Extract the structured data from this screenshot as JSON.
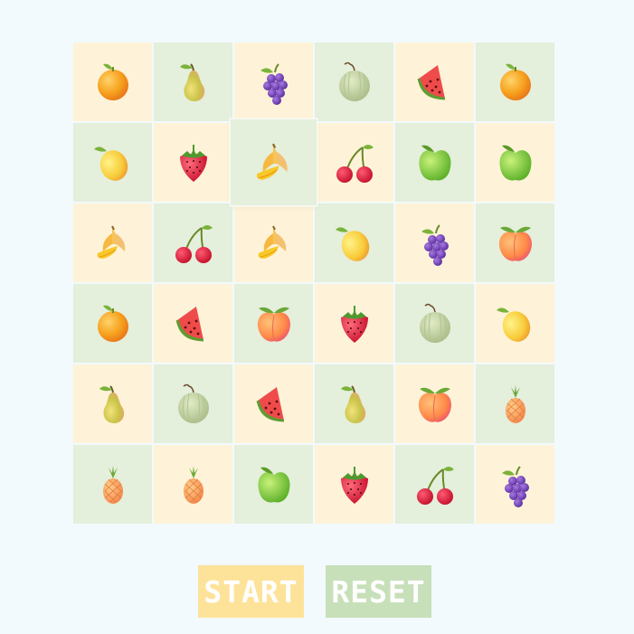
{
  "board": {
    "rows": 6,
    "cols": 6,
    "selected": [
      1,
      2
    ],
    "tiles": [
      [
        "orange",
        "pear",
        "grapes",
        "melon",
        "watermelon",
        "orange"
      ],
      [
        "lemon",
        "strawberry",
        "banana",
        "cherries",
        "green-apple",
        "green-apple"
      ],
      [
        "banana",
        "cherries",
        "banana",
        "lemon",
        "grapes",
        "peach"
      ],
      [
        "orange",
        "watermelon",
        "peach",
        "strawberry",
        "melon",
        "lemon"
      ],
      [
        "pear",
        "melon",
        "watermelon",
        "pear",
        "peach",
        "pineapple"
      ],
      [
        "pineapple",
        "pineapple",
        "green-apple",
        "strawberry",
        "cherries",
        "grapes"
      ]
    ],
    "tile_colors": [
      [
        "yellow",
        "green",
        "yellow",
        "green",
        "yellow",
        "green"
      ],
      [
        "green",
        "yellow",
        "green",
        "yellow",
        "green",
        "yellow"
      ],
      [
        "yellow",
        "green",
        "yellow",
        "green",
        "yellow",
        "green"
      ],
      [
        "green",
        "yellow",
        "green",
        "yellow",
        "green",
        "yellow"
      ],
      [
        "yellow",
        "green",
        "yellow",
        "green",
        "yellow",
        "green"
      ],
      [
        "green",
        "yellow",
        "green",
        "yellow",
        "green",
        "yellow"
      ]
    ]
  },
  "controls": {
    "start_label": "START",
    "reset_label": "RESET"
  },
  "colors": {
    "background": "#f2fafd",
    "tile_yellow": "#fef3d8",
    "tile_green": "#e4efdc",
    "start_button": "#fde39a",
    "reset_button": "#c7e0b9"
  }
}
